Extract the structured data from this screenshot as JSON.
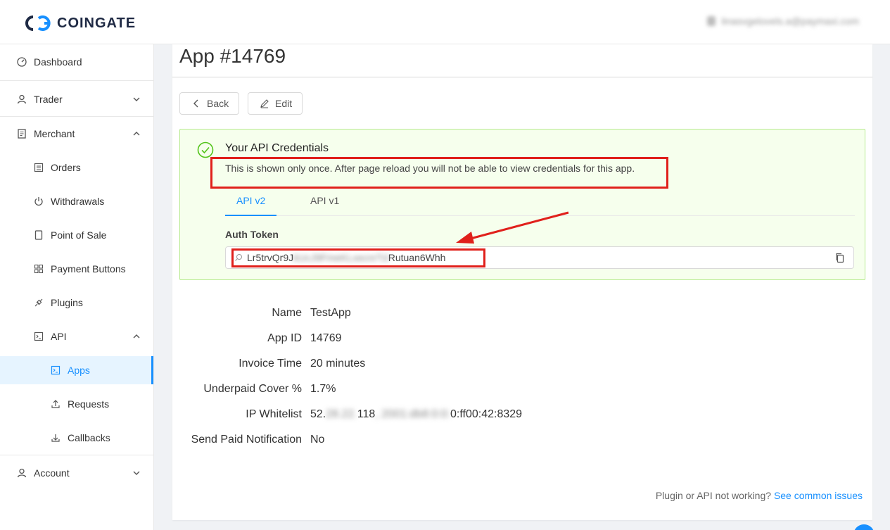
{
  "header": {
    "brand": "COINGATE",
    "user_email": "linasvgelovels.a@paymaxi.com"
  },
  "sidebar": {
    "items": [
      {
        "label": "Dashboard",
        "icon": "dashboard-icon"
      },
      {
        "label": "Trader",
        "icon": "user-icon",
        "chevron": "down"
      },
      {
        "label": "Merchant",
        "icon": "merchant-icon",
        "chevron": "up"
      },
      {
        "label": "Orders",
        "icon": "orders-icon"
      },
      {
        "label": "Withdrawals",
        "icon": "power-icon"
      },
      {
        "label": "Point of Sale",
        "icon": "tablet-icon"
      },
      {
        "label": "Payment Buttons",
        "icon": "grid-icon"
      },
      {
        "label": "Plugins",
        "icon": "plug-icon"
      },
      {
        "label": "API",
        "icon": "terminal-icon",
        "chevron": "up"
      },
      {
        "label": "Apps",
        "icon": "terminal-icon",
        "active": true
      },
      {
        "label": "Requests",
        "icon": "upload-icon"
      },
      {
        "label": "Callbacks",
        "icon": "download-icon"
      },
      {
        "label": "Account",
        "icon": "user-icon",
        "chevron": "down"
      }
    ]
  },
  "main": {
    "title": "App #14769",
    "back_label": "Back",
    "edit_label": "Edit",
    "alert": {
      "title": "Your API Credentials",
      "description": "This is shown only once. After page reload you will not be able to view credentials for this app.",
      "tabs": [
        "API v2",
        "API v1"
      ],
      "active_tab": "API v2",
      "field_label": "Auth Token",
      "token_prefix": "Lr5trvQr9J",
      "token_hidden": "kUcJ9FmeKLxecnrTd",
      "token_suffix": "Rutuan6Whh"
    },
    "details": [
      {
        "label": "Name",
        "value": "TestApp"
      },
      {
        "label": "App ID",
        "value": "14769"
      },
      {
        "label": "Invoice Time",
        "value": "20 minutes"
      },
      {
        "label": "Underpaid Cover %",
        "value": "1.7%"
      },
      {
        "label": "IP Whitelist",
        "value_prefix": "52.",
        "value_hidden_1": "28.22.",
        "value_mid": "118",
        "value_hidden_2": ", 2001:db8:0:0:",
        "value_suffix": "0:ff00:42:8329"
      },
      {
        "label": "Send Paid Notification",
        "value": "No"
      }
    ],
    "footer_text": "Plugin or API not working?",
    "footer_link": "See common issues"
  },
  "colors": {
    "accent": "#1890ff",
    "success_bg": "#f6ffed",
    "success_border": "#b7eb8f",
    "annotation_red": "#e0201b"
  }
}
